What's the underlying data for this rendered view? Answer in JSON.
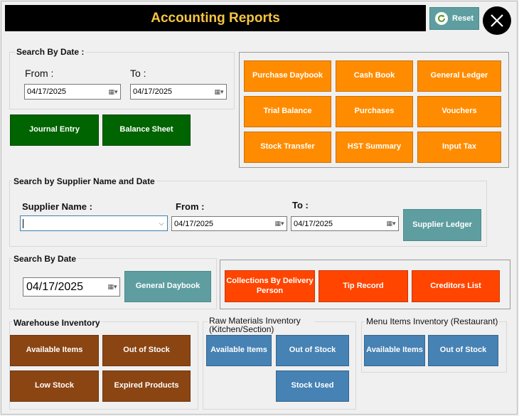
{
  "header": {
    "title": "Accounting Reports",
    "reset_label": "Reset"
  },
  "icons": {
    "reset": "refresh-icon",
    "close": "close-icon"
  },
  "search_by_date": {
    "group_label": "Search By Date :",
    "from_label": "From :",
    "from_value": "04/17/2025",
    "to_label": "To :",
    "to_value": "04/17/2025",
    "journal_entry": "Journal Entry",
    "balance_sheet": "Balance Sheet"
  },
  "reports": [
    "Purchase Daybook",
    "Cash Book",
    "General Ledger",
    "Trial Balance",
    "Purchases",
    "Vouchers",
    "Stock Transfer",
    "HST Summary",
    "Input Tax"
  ],
  "supplier": {
    "group_label": "Search by Supplier Name and Date",
    "name_label": "Supplier Name :",
    "name_value": "",
    "from_label": "From :",
    "from_value": "04/17/2025",
    "to_label": "To :",
    "to_value": "04/17/2025",
    "ledger_button": "Supplier Ledger"
  },
  "daybook": {
    "group_label": "Search By Date",
    "date_value": "04/17/2025",
    "button": "General Daybook"
  },
  "collections": {
    "collections_button": "Collections By Delivery Person",
    "tip_record": "Tip Record",
    "creditors_list": "Creditors List"
  },
  "warehouse": {
    "group_label": "Warehouse Inventory",
    "available": "Available Items",
    "out_of_stock": "Out of Stock",
    "low_stock": "Low Stock",
    "expired": "Expired Products"
  },
  "raw_materials": {
    "group_label": "Raw Materials Inventory (Kitchen/Section)",
    "available": "Available Items",
    "out_of_stock": "Out of Stock",
    "stock_used": "Stock Used"
  },
  "menu_items": {
    "group_label": "Menu Items Inventory (Restaurant)",
    "available": "Available Items",
    "out_of_stock": "Out of Stock"
  },
  "colors": {
    "orange": "#ff8c00",
    "green": "#006400",
    "teal": "#5f9ea0",
    "red": "#ff4500",
    "brown": "#8b4513",
    "blue": "#4682b4"
  }
}
